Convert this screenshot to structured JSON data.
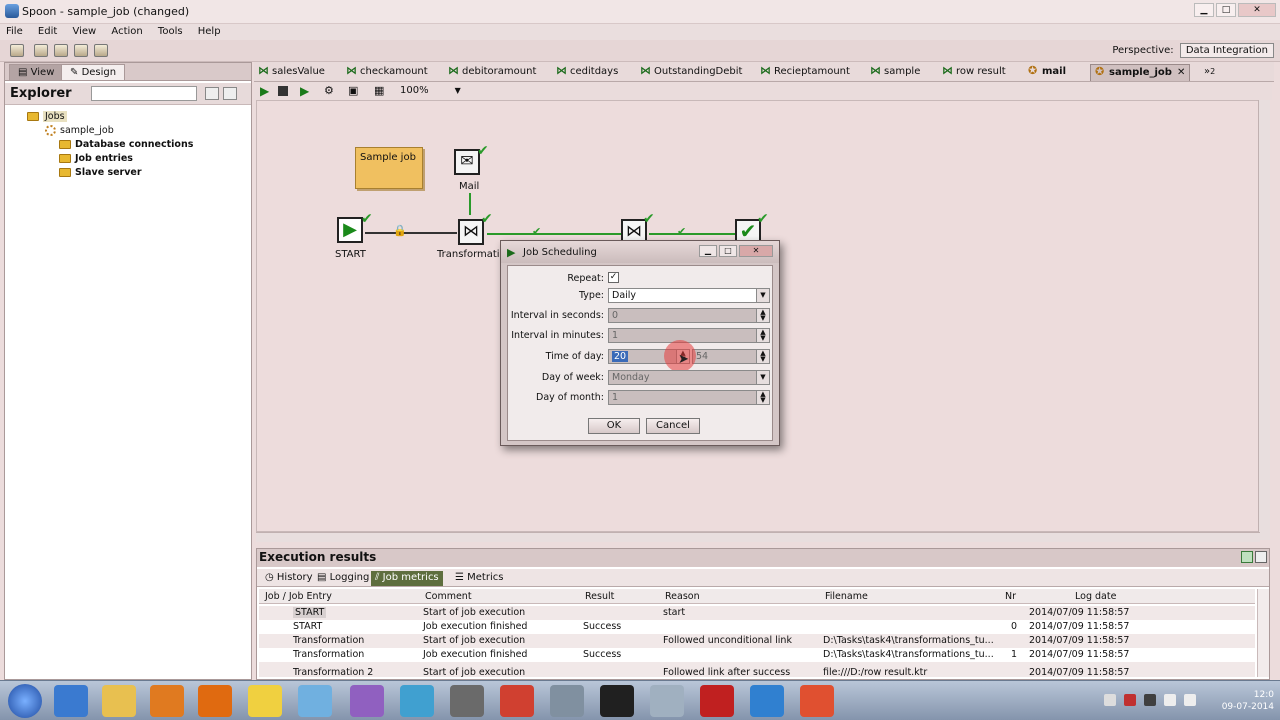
{
  "window": {
    "title": "Spoon - sample_job (changed)"
  },
  "menu": [
    "File",
    "Edit",
    "View",
    "Action",
    "Tools",
    "Help"
  ],
  "perspective": {
    "label": "Perspective:",
    "value": "Data Integration"
  },
  "left_panel": {
    "tabs": [
      "View",
      "Design"
    ],
    "explorer_label": "Explorer",
    "tree": {
      "root": "Jobs",
      "job": "sample_job",
      "children": [
        "Database connections",
        "Job entries",
        "Slave server"
      ]
    }
  },
  "job_tabs": [
    "salesValue",
    "checkamount",
    "debitoramount",
    "ceditdays",
    "OutstandingDebit",
    "Recieptamount",
    "sample",
    "row result",
    "mail",
    "sample_job",
    "2"
  ],
  "canvas_toolbar": {
    "zoom": "100%"
  },
  "canvas": {
    "note": "Sample job",
    "entries": {
      "mail": "Mail",
      "start": "START",
      "transformation": "Transformation"
    }
  },
  "dialog": {
    "title": "Job Scheduling",
    "fields": {
      "repeat_label": "Repeat:",
      "type_label": "Type:",
      "type_value": "Daily",
      "interval_seconds_label": "Interval in seconds:",
      "interval_seconds_value": "0",
      "interval_minutes_label": "Interval in minutes:",
      "interval_minutes_value": "1",
      "time_of_day_label": "Time of day:",
      "time_hour_value": "20",
      "time_min_value": "54",
      "day_of_week_label": "Day of week:",
      "day_of_week_value": "Monday",
      "day_of_month_label": "Day of month:",
      "day_of_month_value": "1"
    },
    "ok_label": "OK",
    "cancel_label": "Cancel"
  },
  "execution": {
    "title": "Execution results",
    "tabs": [
      "History",
      "Logging",
      "Job metrics",
      "Metrics"
    ],
    "columns": [
      "Job / Job Entry",
      "Comment",
      "Result",
      "Reason",
      "Filename",
      "Nr",
      "Log date"
    ],
    "rows": [
      {
        "entry": "START",
        "comment": "Start of job execution",
        "result": "",
        "reason": "start",
        "filename": "",
        "nr": "",
        "date": "2014/07/09 11:58:57"
      },
      {
        "entry": "START",
        "comment": "Job execution finished",
        "result": "Success",
        "reason": "",
        "filename": "",
        "nr": "0",
        "date": "2014/07/09 11:58:57"
      },
      {
        "entry": "Transformation",
        "comment": "Start of job execution",
        "result": "",
        "reason": "Followed unconditional link",
        "filename": "D:\\Tasks\\task4\\transformations_tu...",
        "nr": "",
        "date": "2014/07/09 11:58:57"
      },
      {
        "entry": "Transformation",
        "comment": "Job execution finished",
        "result": "Success",
        "reason": "",
        "filename": "D:\\Tasks\\task4\\transformations_tu...",
        "nr": "1",
        "date": "2014/07/09 11:58:57"
      },
      {
        "entry": "Transformation 2",
        "comment": "Start of job execution",
        "result": "",
        "reason": "Followed link after success",
        "filename": "file:///D:/row result.ktr",
        "nr": "",
        "date": "2014/07/09 11:58:57"
      }
    ]
  },
  "taskbar": {
    "time": "12:0",
    "date": "09-07-2014"
  },
  "colors": {
    "accent_green": "#2a9a2a",
    "note_yellow": "#f0c060",
    "taskbar": "#9aaac0"
  }
}
